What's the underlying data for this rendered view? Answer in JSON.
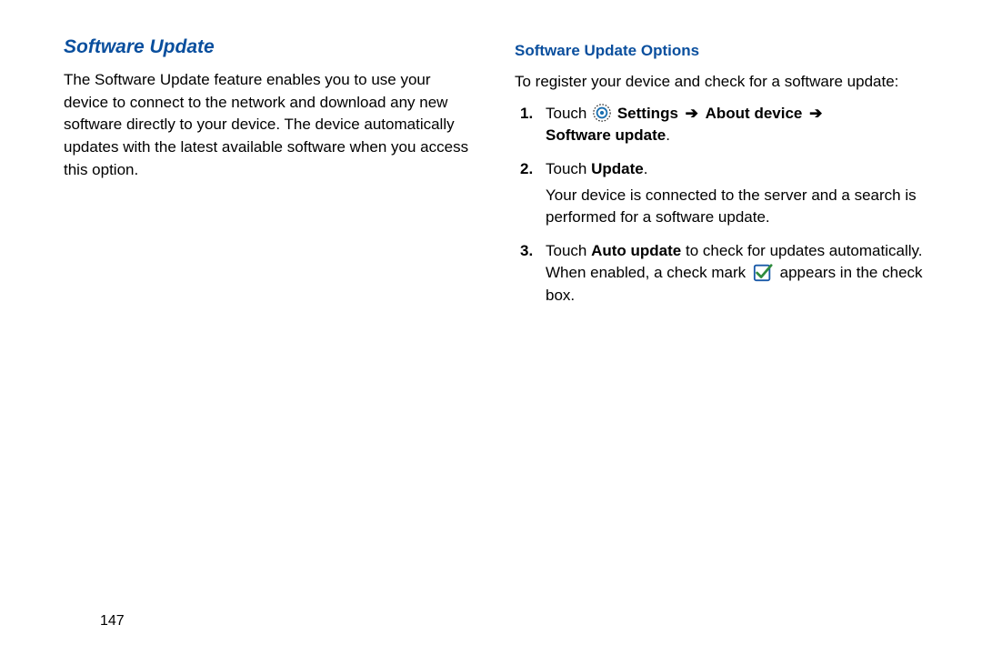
{
  "left": {
    "heading": "Software Update",
    "paragraph": "The Software Update feature enables you to use your device to connect to the network and download any new software directly to your device. The device automatically updates with the latest available software when you access this option."
  },
  "right": {
    "subheading": "Software Update Options",
    "intro": "To register your device and check for a software update:",
    "step1": {
      "touch": "Touch",
      "path1": "Settings",
      "sep": "➔",
      "path2": "About device",
      "sep2": "➔",
      "path3": "Software update",
      "dot": "."
    },
    "step2": {
      "line": "Touch ",
      "bold": "Update",
      "dot": ".",
      "desc": "Your device is connected to the server and a search is performed for a software update."
    },
    "step3": {
      "t1": "Touch ",
      "b1": "Auto update",
      "t2": " to check for updates automatically. When enabled, a check mark ",
      "t3": " appears in the check box."
    }
  },
  "page_number": "147"
}
